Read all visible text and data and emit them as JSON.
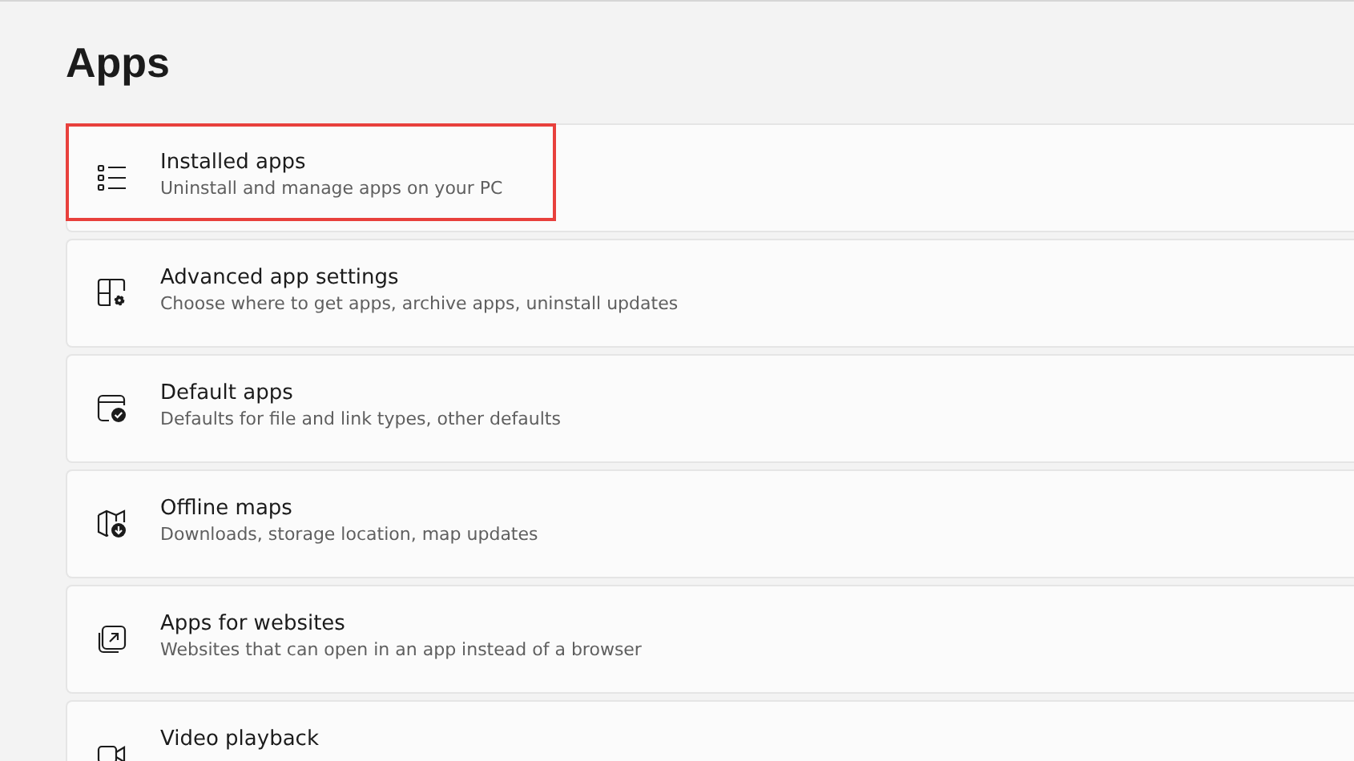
{
  "title": "Apps",
  "items": [
    {
      "kind": "list",
      "title": "Installed apps",
      "subtitle": "Uninstall and manage apps on your PC",
      "highlighted": true
    },
    {
      "kind": "settings",
      "title": "Advanced app settings",
      "subtitle": "Choose where to get apps, archive apps, uninstall updates",
      "highlighted": false
    },
    {
      "kind": "default",
      "title": "Default apps",
      "subtitle": "Defaults for file and link types, other defaults",
      "highlighted": false
    },
    {
      "kind": "map",
      "title": "Offline maps",
      "subtitle": "Downloads, storage location, map updates",
      "highlighted": false
    },
    {
      "kind": "web",
      "title": "Apps for websites",
      "subtitle": "Websites that can open in an app instead of a browser",
      "highlighted": false
    },
    {
      "kind": "video",
      "title": "Video playback",
      "highlighted": false
    }
  ]
}
